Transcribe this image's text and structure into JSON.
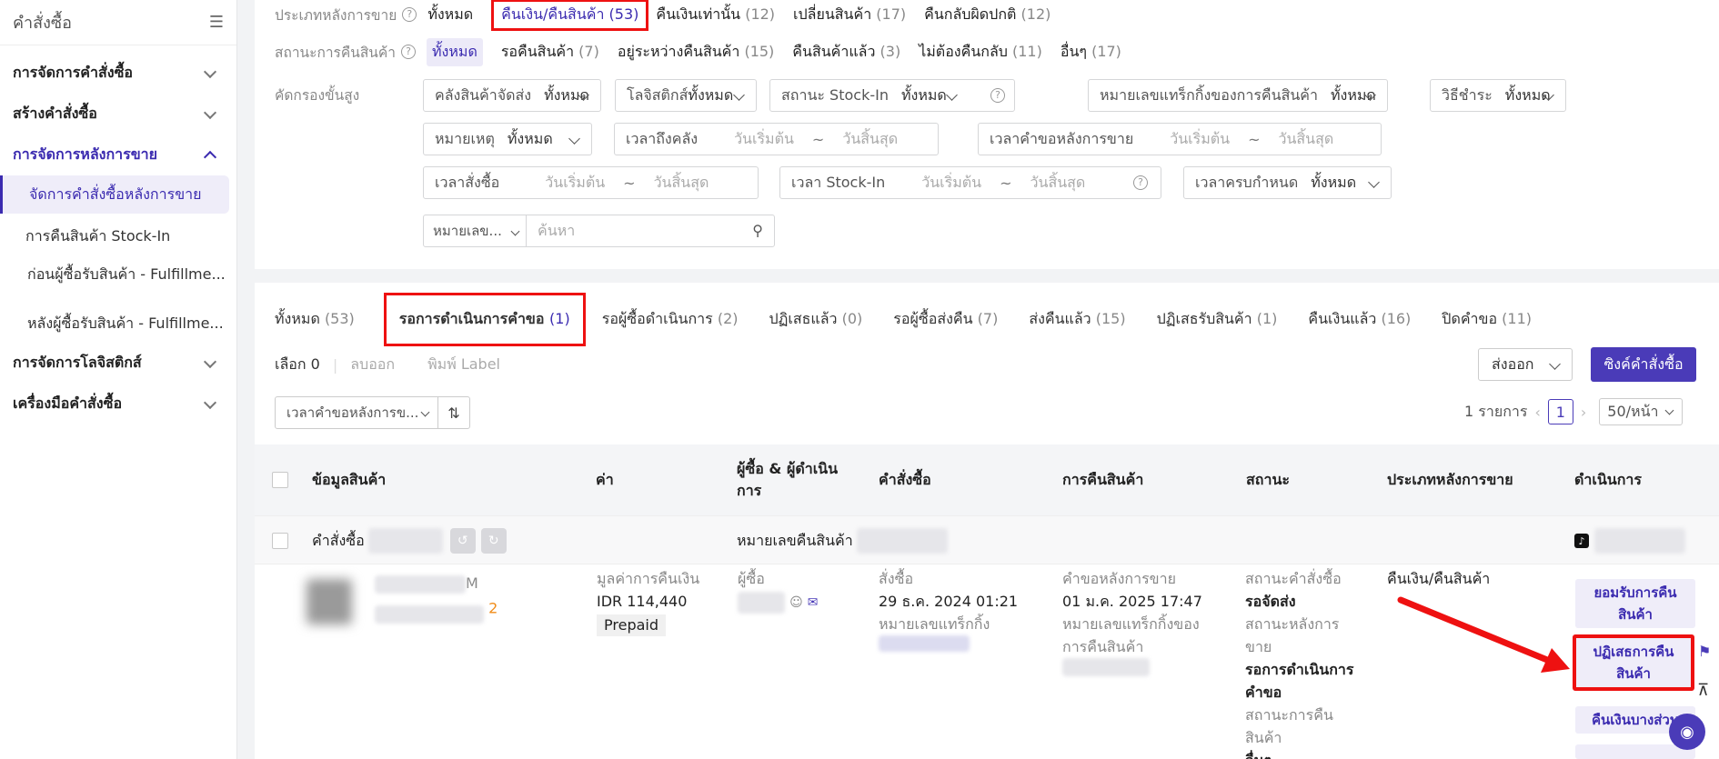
{
  "sidebar": {
    "title": "คำสั่งซื้อ",
    "groups": [
      {
        "label": "การจัดการคำสั่งซื้อ"
      },
      {
        "label": "สร้างคำสั่งซื้อ"
      },
      {
        "label": "การจัดการหลังการขาย"
      },
      {
        "label": "การจัดการโลจิสติกส์"
      },
      {
        "label": "เครื่องมือคำสั่งซื้อ"
      }
    ],
    "items": [
      {
        "label": "จัดการคำสั่งซื้อหลังการขาย"
      },
      {
        "label": "การคืนสินค้า Stock-In"
      },
      {
        "label": "ก่อนผู้ซื้อรับสินค้า - Fulfillme..."
      },
      {
        "label": "หลังผู้ซื้อรับสินค้า - Fulfillme..."
      }
    ]
  },
  "filters": {
    "aftersale_type": {
      "label": "ประเภทหลังการขาย",
      "options": [
        {
          "label": "ทั้งหมด",
          "count": ""
        },
        {
          "label": "คืนเงิน/คืนสินค้า",
          "count": "(53)"
        },
        {
          "label": "คืนเงินเท่านั้น",
          "count": "(12)"
        },
        {
          "label": "เปลี่ยนสินค้า",
          "count": "(17)"
        },
        {
          "label": "คืนกลับผิดปกติ",
          "count": "(12)"
        }
      ]
    },
    "return_status": {
      "label": "สถานะการคืนสินค้า",
      "options": [
        {
          "label": "ทั้งหมด",
          "count": ""
        },
        {
          "label": "รอคืนสินค้า",
          "count": "(7)"
        },
        {
          "label": "อยู่ระหว่างคืนสินค้า",
          "count": "(15)"
        },
        {
          "label": "คืนสินค้าแล้ว",
          "count": "(3)"
        },
        {
          "label": "ไม่ต้องคืนกลับ",
          "count": "(11)"
        },
        {
          "label": "อื่นๆ",
          "count": "(17)"
        }
      ]
    },
    "advanced_label": "คัดกรองขั้นสูง",
    "warehouse": {
      "label": "คลังสินค้าจัดส่ง",
      "value": "ทั้งหมด"
    },
    "logistics": {
      "label": "โลจิสติกส์",
      "value": "ทั้งหมด"
    },
    "stockin_status": {
      "label": "สถานะ Stock-In",
      "value": "ทั้งหมด"
    },
    "tracking": {
      "label": "หมายเลขแทร็กกิ้งของการคืนสินค้า",
      "value": "ทั้งหมด"
    },
    "payment": {
      "label": "วิธีชำระ",
      "value": "ทั้งหมด"
    },
    "reason": {
      "label": "หมายเหตุ",
      "value": "ทั้งหมด"
    },
    "arrive_time": {
      "label": "เวลาถึงคลัง",
      "start": "วันเริ่มต้น",
      "end": "วันสิ้นสุด"
    },
    "request_time": {
      "label": "เวลาคำขอหลังการขาย",
      "start": "วันเริ่มต้น",
      "end": "วันสิ้นสุด"
    },
    "order_time": {
      "label": "เวลาสั่งซื้อ",
      "start": "วันเริ่มต้น",
      "end": "วันสิ้นสุด"
    },
    "stockin_time": {
      "label": "เวลา Stock-In",
      "start": "วันเริ่มต้น",
      "end": "วันสิ้นสุด"
    },
    "due_time": {
      "label": "เวลาครบกำหนด",
      "value": "ทั้งหมด"
    },
    "search": {
      "type_label": "หมายเลข...",
      "placeholder": "ค้นหา"
    },
    "dash": "~"
  },
  "tabs": [
    {
      "label": "ทั้งหมด",
      "count": "(53)"
    },
    {
      "label": "รอการดำเนินการคำขอ",
      "count": "(1)"
    },
    {
      "label": "รอผู้ซื้อดำเนินการ",
      "count": "(2)"
    },
    {
      "label": "ปฏิเสธแล้ว",
      "count": "(0)"
    },
    {
      "label": "รอผู้ซื้อส่งคืน",
      "count": "(7)"
    },
    {
      "label": "ส่งคืนแล้ว",
      "count": "(15)"
    },
    {
      "label": "ปฏิเสธรับสินค้า",
      "count": "(1)"
    },
    {
      "label": "คืนเงินแล้ว",
      "count": "(16)"
    },
    {
      "label": "ปิดคำขอ",
      "count": "(11)"
    }
  ],
  "toolbar": {
    "selected": "เลือก 0",
    "clear": "ลบออก",
    "print": "พิมพ์ Label",
    "export": "ส่งออก",
    "sync": "ซิงค์คำสั่งซื้อ",
    "sort": "เวลาคำขอหลังการข..."
  },
  "pager": {
    "total": "1 รายการ",
    "current": "1",
    "size": "50/หน้า"
  },
  "table": {
    "headers": [
      "ข้อมูลสินค้า",
      "ค่า",
      "ผู้ซื้อ & ผู้ดำเนินการ",
      "คำสั่งซื้อ",
      "การคืนสินค้า",
      "สถานะ",
      "ประเภทหลังการขาย",
      "ดำเนินการ"
    ],
    "order_row": {
      "order_label": "คำสั่งซื้อ",
      "return_label": "หมายเลขคืนสินค้า"
    },
    "row": {
      "product_suffix": "M",
      "qty": "2",
      "value_label": "มูลค่าการคืนเงิน",
      "value": "IDR 114,440",
      "payment_badge": "Prepaid",
      "buyer_label": "ผู้ซื้อ",
      "order_label": "สั่งซื้อ",
      "order_time": "29 ธ.ค. 2024 01:21",
      "order_tracking_label": "หมายเลขแทร็กกิ้ง",
      "request_label": "คำขอหลังการขาย",
      "request_time": "01 ม.ค. 2025 17:47",
      "return_tracking_label": "หมายเลขแทร็กกิ้งของการคืนสินค้า",
      "status_order_label": "สถานะคำสั่งซื้อ",
      "status_order_value": "รอจัดส่ง",
      "status_aftersale_label": "สถานะหลังการขาย",
      "status_aftersale_value": "รอการดำเนินการคำขอ",
      "status_return_label": "สถานะการคืนสินค้า",
      "status_return_value": "อื่นๆ",
      "type": "คืนเงิน/คืนสินค้า",
      "actions": [
        "ยอมรับการคืนสินค้า",
        "ปฏิเสธการคืนสินค้า",
        "คืนเงินบางส่วน"
      ]
    }
  },
  "colors": {
    "accent": "#4a3bb8",
    "highlight": "#e11111"
  }
}
